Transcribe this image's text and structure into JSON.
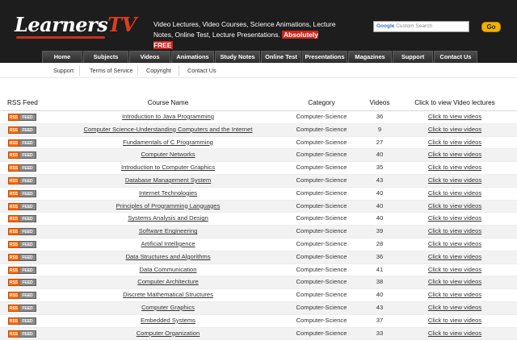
{
  "header": {
    "logo_main": "Learners",
    "logo_tv": "TV",
    "tagline": "Video Lectures, Video Courses, Science Animations, Lecture Notes, Online Test, Lecture Presentations.",
    "tagline_free": "Absolutely FREE",
    "search": {
      "brand": "Google",
      "placeholder": "Custom Search"
    },
    "go_label": "Go"
  },
  "nav": [
    "Home",
    "Subjects",
    "Videos",
    "Animations",
    "Study Notes",
    "Online Test",
    "Presentations",
    "Magazines",
    "Support",
    "Contact Us"
  ],
  "subnav": [
    "Support",
    "Terms of Service",
    "Copyright",
    "Contact Us"
  ],
  "table": {
    "headers": {
      "rss": "RSS Feed",
      "name": "Course Name",
      "category": "Category",
      "videos": "Videos",
      "link": "Click to view Video lectures"
    },
    "rss_badge": {
      "left": "RSS",
      "right": "FEED"
    },
    "link_label": "Click to view videos",
    "rows": [
      {
        "name": "Introduction to Java Programming",
        "category": "Computer-Science",
        "videos": "36"
      },
      {
        "name": "Computer Science-Understanding Computers and the Internet",
        "category": "Computer-Science",
        "videos": "9"
      },
      {
        "name": "Fundamentals of C Programming",
        "category": "Computer-Science",
        "videos": "27"
      },
      {
        "name": "Computer Networks",
        "category": "Computer-Science",
        "videos": "40"
      },
      {
        "name": "Introduction to Computer Graphics",
        "category": "Computer-Science",
        "videos": "35"
      },
      {
        "name": "Database Management System",
        "category": "Computer-Science",
        "videos": "43"
      },
      {
        "name": "Internet Technologies",
        "category": "Computer-Science",
        "videos": "40"
      },
      {
        "name": "Principles of Programming Languages",
        "category": "Computer-Science",
        "videos": "40"
      },
      {
        "name": "Systems Analysis and Design",
        "category": "Computer-Science",
        "videos": "40"
      },
      {
        "name": "Software Engineering",
        "category": "Computer-Science",
        "videos": "39"
      },
      {
        "name": "Artificial Intelligence",
        "category": "Computer-Science",
        "videos": "28"
      },
      {
        "name": "Data Structures and Algorithms",
        "category": "Computer-Science",
        "videos": "36"
      },
      {
        "name": "Data Communication",
        "category": "Computer-Science",
        "videos": "41"
      },
      {
        "name": "Computer Architecture",
        "category": "Computer-Science",
        "videos": "38"
      },
      {
        "name": "Discrete Mathematical Structures",
        "category": "Computer-Science",
        "videos": "40"
      },
      {
        "name": "Computer Graphics",
        "category": "Computer-Science",
        "videos": "43"
      },
      {
        "name": "Embedded Systems",
        "category": "Computer-Science",
        "videos": "37"
      },
      {
        "name": "Computer Organization",
        "category": "Computer-Science",
        "videos": "33"
      }
    ]
  }
}
